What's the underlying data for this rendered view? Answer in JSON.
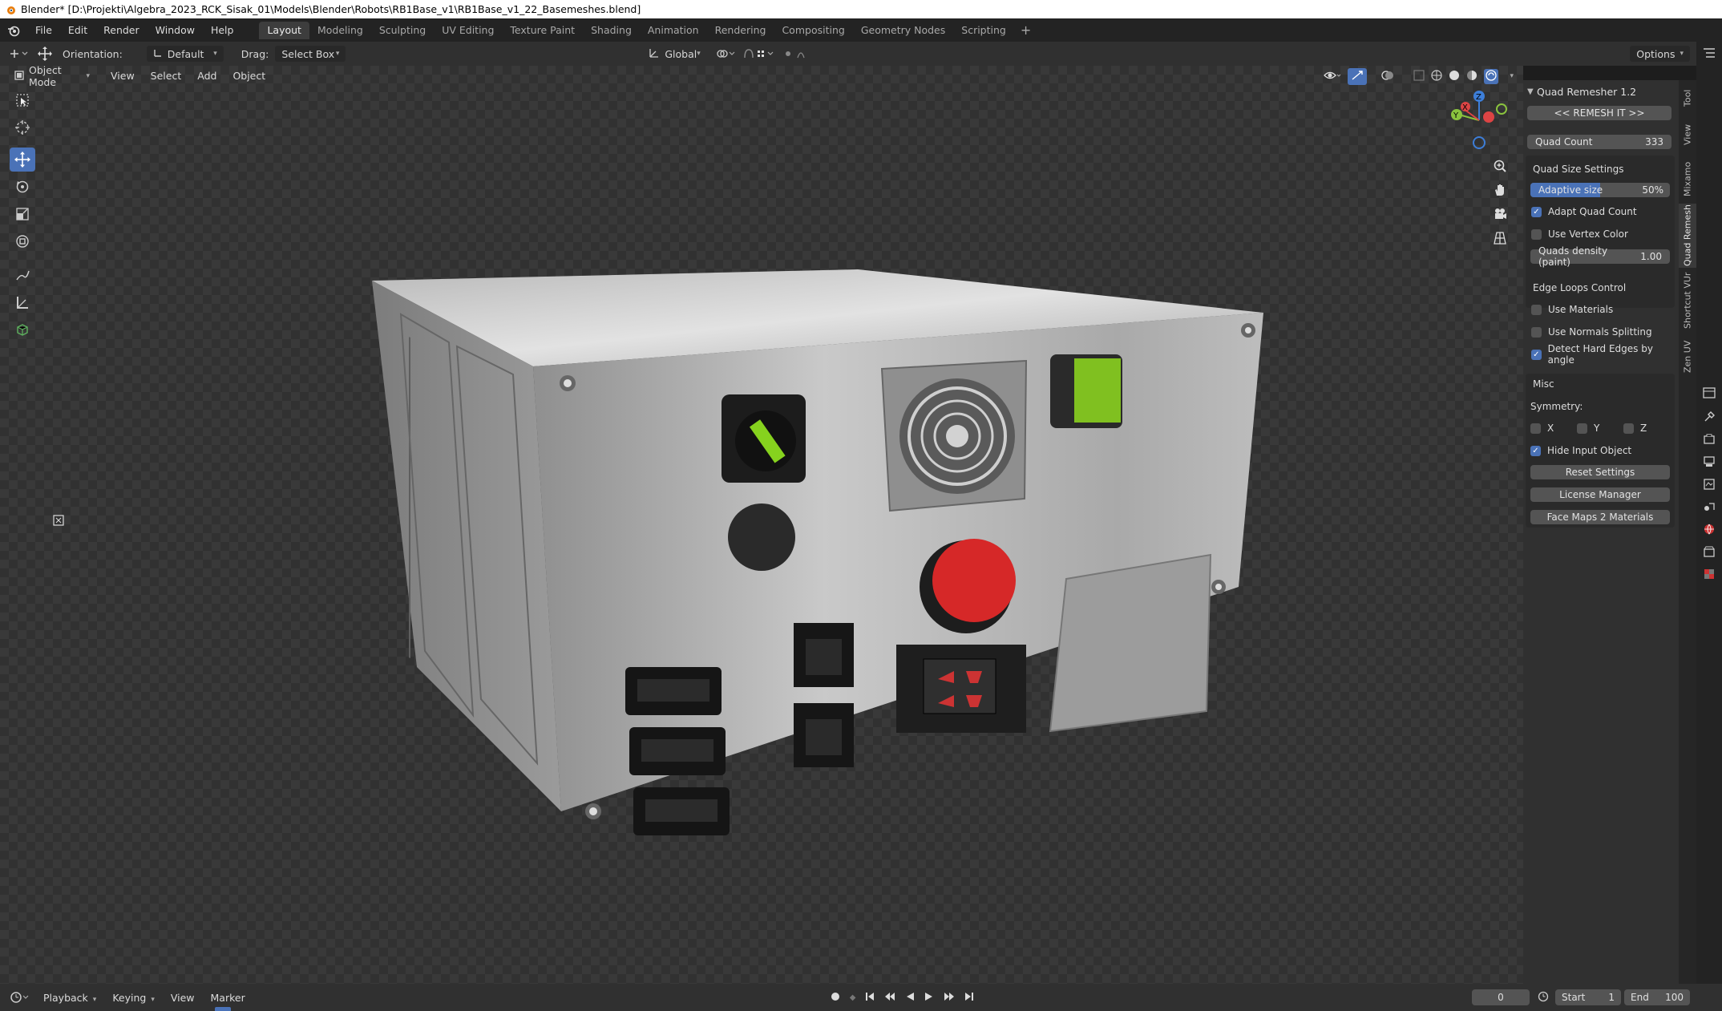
{
  "window": {
    "title": "Blender* [D:\\Projekti\\Algebra_2023_RCK_Sisak_01\\Models\\Blender\\Robots\\RB1Base_v1\\RB1Base_v1_22_Basemeshes.blend]"
  },
  "menu": {
    "items": [
      "File",
      "Edit",
      "Render",
      "Window",
      "Help"
    ]
  },
  "workspaces": {
    "tabs": [
      "Layout",
      "Modeling",
      "Sculpting",
      "UV Editing",
      "Texture Paint",
      "Shading",
      "Animation",
      "Rendering",
      "Compositing",
      "Geometry Nodes",
      "Scripting"
    ],
    "active": "Layout",
    "add": "+"
  },
  "header": {
    "orientation_label": "Orientation:",
    "orientation_value": "Default",
    "drag_label": "Drag:",
    "drag_value": "Select Box",
    "transform_orientation": "Global",
    "options_label": "Options"
  },
  "viewport_header": {
    "mode": "Object Mode",
    "menus": [
      "View",
      "Select",
      "Add",
      "Object"
    ]
  },
  "gizmo": {
    "axes": [
      "X",
      "Y",
      "Z"
    ]
  },
  "addon_panel": {
    "title": "Quad Remesher 1.2",
    "remesh_button": "<< REMESH IT >>",
    "quad_count_label": "Quad Count",
    "quad_count_value": "333",
    "quad_size_section": "Quad Size Settings",
    "adaptive_size_label": "Adaptive size",
    "adaptive_size_value": "50%",
    "adaptive_size_fraction": 0.5,
    "adapt_quad_count": {
      "label": "Adapt Quad Count",
      "checked": true
    },
    "use_vertex_color": {
      "label": "Use Vertex Color",
      "checked": false
    },
    "quads_density_label": "Quads density (paint)",
    "quads_density_value": "1.00",
    "edge_loops_section": "Edge Loops Control",
    "use_materials": {
      "label": "Use Materials",
      "checked": false
    },
    "use_normals_splitting": {
      "label": "Use Normals Splitting",
      "checked": false
    },
    "detect_hard_edges": {
      "label": "Detect Hard Edges by angle",
      "checked": true
    },
    "misc_section": "Misc",
    "symmetry_label": "Symmetry:",
    "sym_x": {
      "label": "X",
      "checked": false
    },
    "sym_y": {
      "label": "Y",
      "checked": false
    },
    "sym_z": {
      "label": "Z",
      "checked": false
    },
    "hide_input_object": {
      "label": "Hide Input Object",
      "checked": true
    },
    "reset_settings": "Reset Settings",
    "license_manager": "License Manager",
    "face_maps": "Face Maps 2 Materials"
  },
  "sidebar_tabs": [
    "Tool",
    "View",
    "Mixamo",
    "Quad Remesh",
    "Shortcut VUr",
    "Zen UV"
  ],
  "sidebar_active_tab": "Quad Remesh",
  "timeline": {
    "menus": [
      "Playback",
      "Keying",
      "View",
      "Marker"
    ],
    "current_frame": "0",
    "start_label": "Start",
    "start_value": "1",
    "end_label": "End",
    "end_value": "100"
  },
  "colors": {
    "accent": "#4a72b7",
    "panel_bg": "#303030",
    "field_bg": "#545454"
  }
}
